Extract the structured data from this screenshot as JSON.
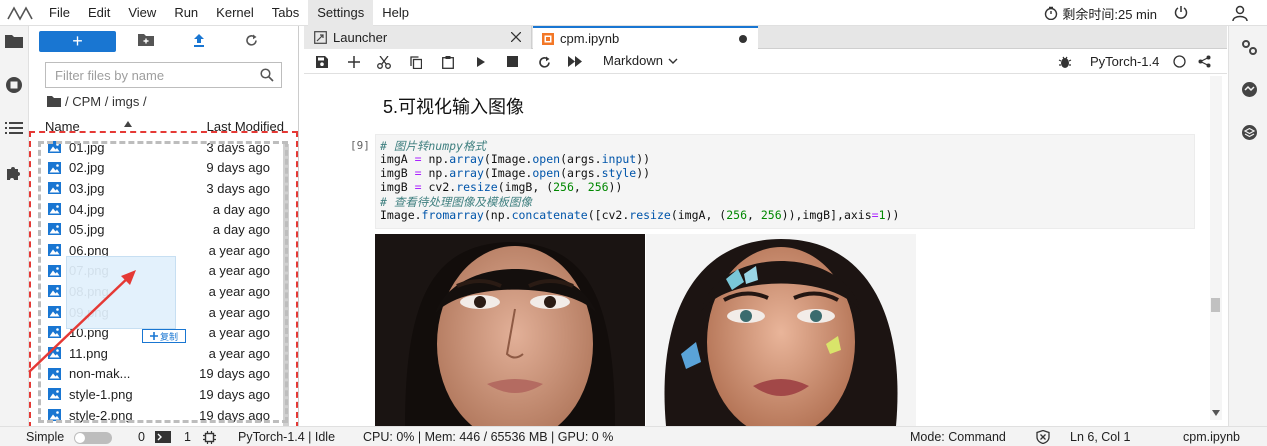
{
  "menu": {
    "items": [
      "File",
      "Edit",
      "View",
      "Run",
      "Kernel",
      "Tabs",
      "Settings",
      "Help"
    ],
    "active": "Settings",
    "timer_text": "剩余时间:25 min"
  },
  "filebrowser": {
    "new_label": "+",
    "search_placeholder": "Filter files by name",
    "breadcrumb": "/ CPM / imgs /",
    "header_name": "Name",
    "header_modified": "Last Modified",
    "files": [
      {
        "name": "01.jpg",
        "modified": "3 days ago"
      },
      {
        "name": "02.jpg",
        "modified": "9 days ago"
      },
      {
        "name": "03.jpg",
        "modified": "3 days ago"
      },
      {
        "name": "04.jpg",
        "modified": "a day ago"
      },
      {
        "name": "05.jpg",
        "modified": "a day ago"
      },
      {
        "name": "06.png",
        "modified": "a year ago"
      },
      {
        "name": "07.png",
        "modified": "a year ago"
      },
      {
        "name": "08.png",
        "modified": "a year ago"
      },
      {
        "name": "09.png",
        "modified": "a year ago"
      },
      {
        "name": "10.png",
        "modified": "a year ago"
      },
      {
        "name": "11.png",
        "modified": "a year ago"
      },
      {
        "name": "non-mak...",
        "modified": "19 days ago"
      },
      {
        "name": "style-1.png",
        "modified": "19 days ago"
      },
      {
        "name": "style-2.png",
        "modified": "19 days ago"
      }
    ],
    "copy_badge": "复制"
  },
  "tabs": {
    "launcher": "Launcher",
    "notebook": "cpm.ipynb"
  },
  "toolbar": {
    "cell_type": "Markdown",
    "kernel": "PyTorch-1.4"
  },
  "notebook": {
    "heading": "5.可视化输入图像",
    "prompt": "[9]",
    "code": {
      "c1": "# 图片转numpy格式",
      "c2": "# 查看待处理图像及模板图像"
    }
  },
  "status": {
    "mode_label": "Simple",
    "count_a": "0",
    "count_b": "1",
    "kernel_status": "PyTorch-1.4 | Idle",
    "resources": "CPU: 0% | Mem: 446 / 65536 MB | GPU: 0 %",
    "mode": "Mode: Command",
    "position": "Ln 6, Col 1",
    "file": "cpm.ipynb"
  },
  "colors": {
    "accent": "#1976d2",
    "highlight": "#e53935"
  }
}
